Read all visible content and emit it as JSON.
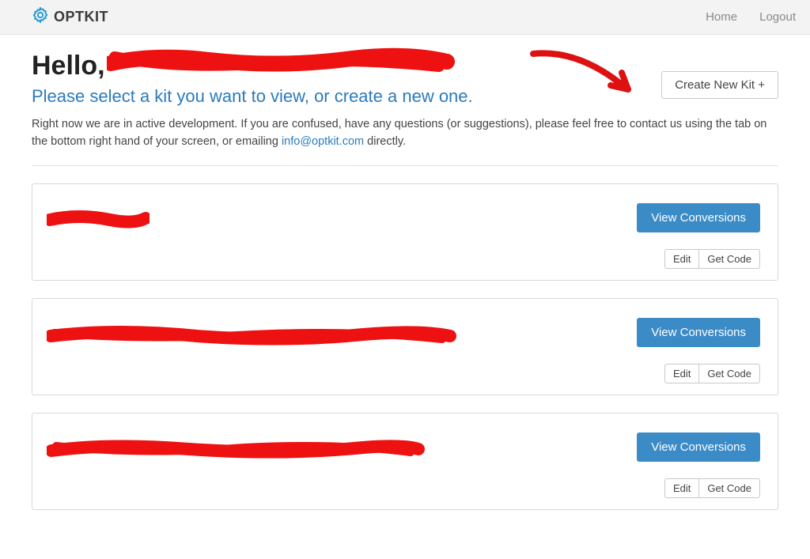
{
  "brand": {
    "name": "OPTKIT"
  },
  "nav": {
    "home": "Home",
    "logout": "Logout"
  },
  "header": {
    "hello": "Hello,",
    "subtitle": "Please select a kit you want to view, or create a new one.",
    "create_label": "Create New Kit +"
  },
  "notice": {
    "pre": "Right now we are in active development. If you are confused, have any questions (or suggestions), please feel free to contact us using the tab on the bottom right hand of your screen, or emailing ",
    "email": "info@optkit.com",
    "post": " directly."
  },
  "kit_actions": {
    "view": "View Conversions",
    "edit": "Edit",
    "get_code": "Get Code"
  },
  "kits": [
    {
      "name": ""
    },
    {
      "name": ""
    },
    {
      "name": ""
    }
  ]
}
